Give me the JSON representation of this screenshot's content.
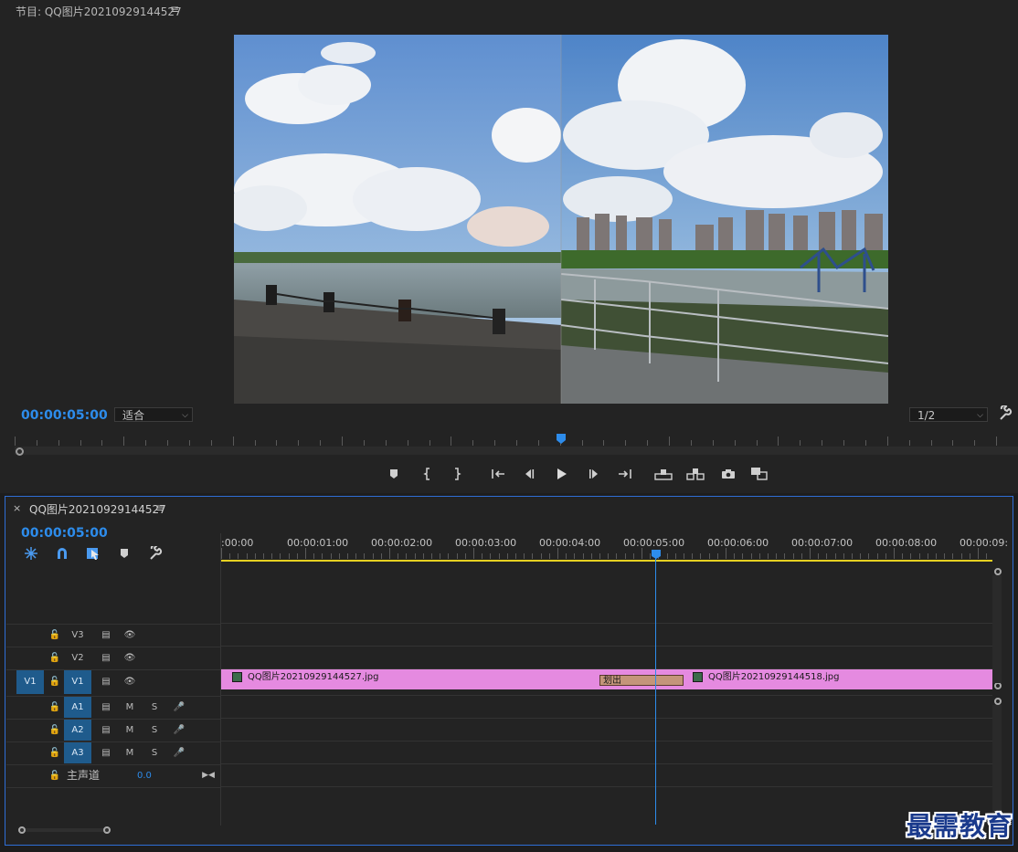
{
  "program_monitor": {
    "title": "节目: QQ图片20210929144527",
    "menu_glyph": "≡",
    "timecode": "00:00:05:00",
    "fit_dropdown": "适合",
    "resolution_dropdown": "1/2",
    "playhead_fraction": 0.545
  },
  "transport": {
    "buttons": [
      "add-marker",
      "mark-in",
      "mark-out",
      "go-to-in",
      "step-back",
      "play",
      "step-forward",
      "go-to-out",
      "lift",
      "extract",
      "export-frame",
      "comparison-view"
    ]
  },
  "timeline": {
    "tab_close": "×",
    "sequence_name": "QQ图片20210929144527",
    "menu_glyph": "≡",
    "timecode": "00:00:05:00",
    "ruler_labels": [
      ":00:00",
      "00:00:01:00",
      "00:00:02:00",
      "00:00:03:00",
      "00:00:04:00",
      "00:00:05:00",
      "00:00:06:00",
      "00:00:07:00",
      "00:00:08:00",
      "00:00:09:"
    ],
    "tracks": {
      "v3": "V3",
      "v2": "V2",
      "v1_source": "V1",
      "v1": "V1",
      "a1": "A1",
      "a2": "A2",
      "a3": "A3",
      "mute": "M",
      "solo": "S",
      "master_label": "主声道",
      "master_value": "0.0"
    },
    "clips": {
      "clip1": "QQ图片20210929144527.jpg",
      "clip2": "QQ图片20210929144518.jpg",
      "transition": "划出"
    }
  },
  "watermark": "最需教育",
  "colors": {
    "accent": "#2d8ceb",
    "clip": "#e58ae0",
    "transition": "#c4957a",
    "work_area": "#e6d021"
  }
}
